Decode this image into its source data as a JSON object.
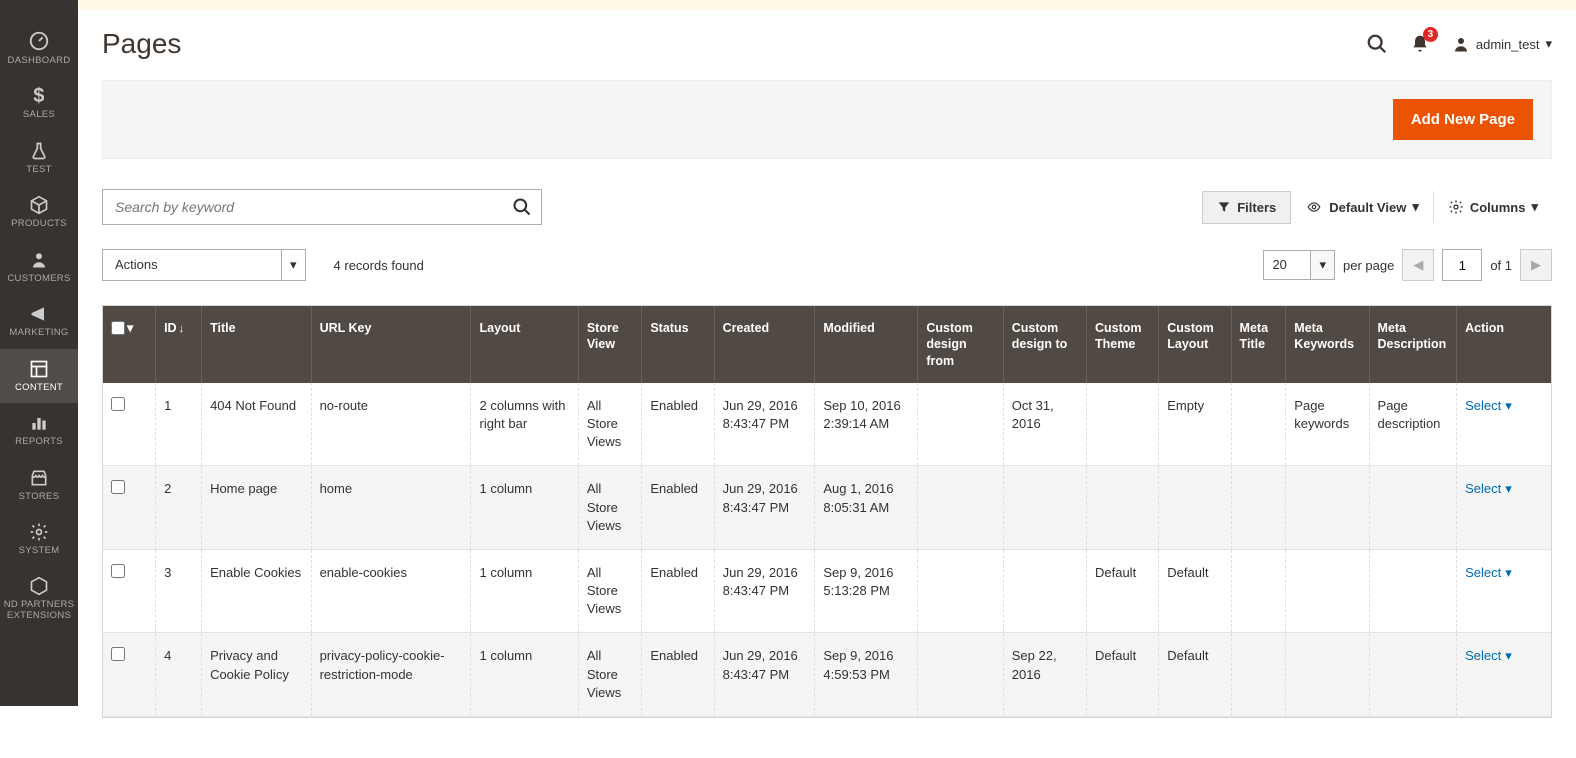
{
  "sidebar": {
    "items": [
      {
        "label": "DASHBOARD"
      },
      {
        "label": "SALES"
      },
      {
        "label": "TEST"
      },
      {
        "label": "PRODUCTS"
      },
      {
        "label": "CUSTOMERS"
      },
      {
        "label": "MARKETING"
      },
      {
        "label": "CONTENT"
      },
      {
        "label": "REPORTS"
      },
      {
        "label": "STORES"
      },
      {
        "label": "SYSTEM"
      },
      {
        "label": "ND PARTNERS EXTENSIONS"
      }
    ]
  },
  "header": {
    "title": "Pages",
    "notifications": "3",
    "user": "admin_test"
  },
  "buttons": {
    "add_new": "Add New Page"
  },
  "toolbar": {
    "search_placeholder": "Search by keyword",
    "filters": "Filters",
    "default_view": "Default View",
    "columns": "Columns",
    "actions": "Actions",
    "records_found": "4 records found",
    "per_page_value": "20",
    "per_page_label": "per page",
    "page_current": "1",
    "page_total_label": "of 1"
  },
  "table": {
    "headers": {
      "id": "ID",
      "title": "Title",
      "url_key": "URL Key",
      "layout": "Layout",
      "store_view": "Store View",
      "status": "Status",
      "created": "Created",
      "modified": "Modified",
      "custom_design_from": "Custom design from",
      "custom_design_to": "Custom design to",
      "custom_theme": "Custom Theme",
      "custom_layout": "Custom Layout",
      "meta_title": "Meta Title",
      "meta_keywords": "Meta Keywords",
      "meta_description": "Meta Description",
      "action": "Action"
    },
    "rows": [
      {
        "id": "1",
        "title": "404 Not Found",
        "url_key": "no-route",
        "layout": "2 columns with right bar",
        "store_view": "All Store Views",
        "status": "Enabled",
        "created": "Jun 29, 2016 8:43:47 PM",
        "modified": "Sep 10, 2016 2:39:14 AM",
        "custom_design_from": "",
        "custom_design_to": "Oct 31, 2016",
        "custom_theme": "",
        "custom_layout": "Empty",
        "meta_title": "",
        "meta_keywords": "Page keywords",
        "meta_description": "Page description",
        "action": "Select"
      },
      {
        "id": "2",
        "title": "Home page",
        "url_key": "home",
        "layout": "1 column",
        "store_view": "All Store Views",
        "status": "Enabled",
        "created": "Jun 29, 2016 8:43:47 PM",
        "modified": "Aug 1, 2016 8:05:31 AM",
        "custom_design_from": "",
        "custom_design_to": "",
        "custom_theme": "",
        "custom_layout": "",
        "meta_title": "",
        "meta_keywords": "",
        "meta_description": "",
        "action": "Select"
      },
      {
        "id": "3",
        "title": "Enable Cookies",
        "url_key": "enable-cookies",
        "layout": "1 column",
        "store_view": "All Store Views",
        "status": "Enabled",
        "created": "Jun 29, 2016 8:43:47 PM",
        "modified": "Sep 9, 2016 5:13:28 PM",
        "custom_design_from": "",
        "custom_design_to": "",
        "custom_theme": "Default",
        "custom_layout": "Default",
        "meta_title": "",
        "meta_keywords": "",
        "meta_description": "",
        "action": "Select"
      },
      {
        "id": "4",
        "title": "Privacy and Cookie Policy",
        "url_key": "privacy-policy-cookie-restriction-mode",
        "layout": "1 column",
        "store_view": "All Store Views",
        "status": "Enabled",
        "created": "Jun 29, 2016 8:43:47 PM",
        "modified": "Sep 9, 2016 4:59:53 PM",
        "custom_design_from": "",
        "custom_design_to": "Sep 22, 2016",
        "custom_theme": "Default",
        "custom_layout": "Default",
        "meta_title": "",
        "meta_keywords": "",
        "meta_description": "",
        "action": "Select"
      }
    ]
  }
}
